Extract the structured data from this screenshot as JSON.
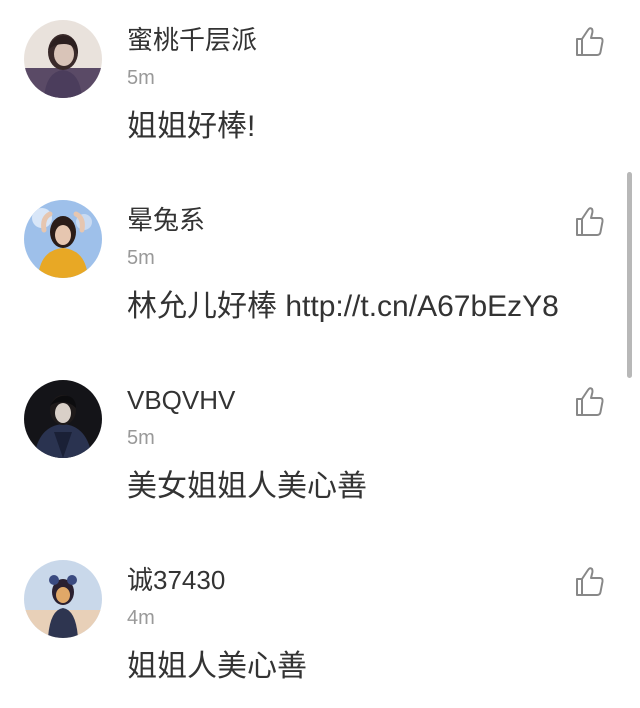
{
  "comments": [
    {
      "username": "蜜桃千层派",
      "time": "5m",
      "text": "姐姐好棒!",
      "avatar_colors": [
        "#5a4a66",
        "#d9c4b8",
        "#3a2a2a"
      ]
    },
    {
      "username": "晕兔系",
      "time": "5m",
      "text": "林允儿好棒 http://t.cn/A67bEzY8",
      "avatar_colors": [
        "#8fb0e0",
        "#e8a825",
        "#2a1c18"
      ]
    },
    {
      "username": "VBQVHV",
      "time": "5m",
      "text": "美女姐姐人美心善",
      "avatar_colors": [
        "#141418",
        "#2a3350",
        "#d9d0c8"
      ]
    },
    {
      "username": "诚37430",
      "time": "4m",
      "text": "姐姐人美心善",
      "avatar_colors": [
        "#c9d8ea",
        "#2e3550",
        "#e0a868"
      ]
    }
  ],
  "like_icon": "thumbs-up-icon",
  "accent_color": "#333333",
  "meta_color": "#999999"
}
